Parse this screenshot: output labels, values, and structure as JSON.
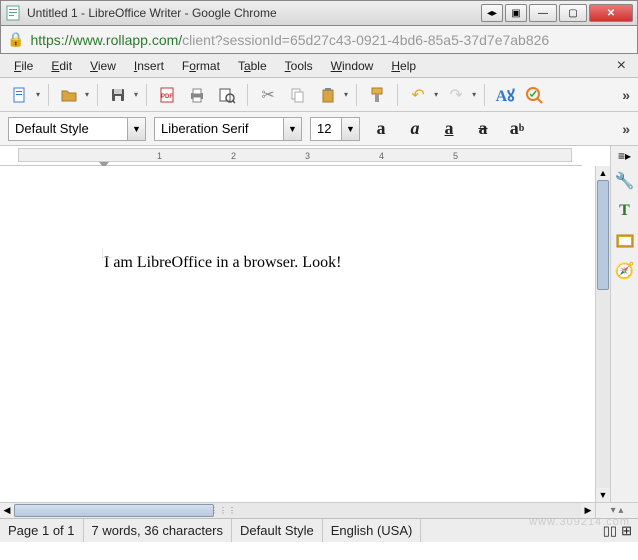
{
  "chrome": {
    "title": "Untitled 1 - LibreOffice Writer - Google Chrome",
    "url_host": "https://www.rollapp.com/",
    "url_path": "client?sessionId=65d27c43-0921-4bd6-85a5-37d7e7ab826"
  },
  "menu": {
    "items": [
      "File",
      "Edit",
      "View",
      "Insert",
      "Format",
      "Table",
      "Tools",
      "Window",
      "Help"
    ]
  },
  "format": {
    "para_style": "Default Style",
    "font_name": "Liberation Serif",
    "font_size": "12"
  },
  "ruler": {
    "ticks": [
      "1",
      "2",
      "3",
      "4",
      "5"
    ]
  },
  "document": {
    "body_text": "I am LibreOffice in a browser. Look!"
  },
  "status": {
    "page": "Page 1 of 1",
    "words": "7 words, 36 characters",
    "style": "Default Style",
    "lang": "English (USA)"
  },
  "watermark": "www.309214.com"
}
